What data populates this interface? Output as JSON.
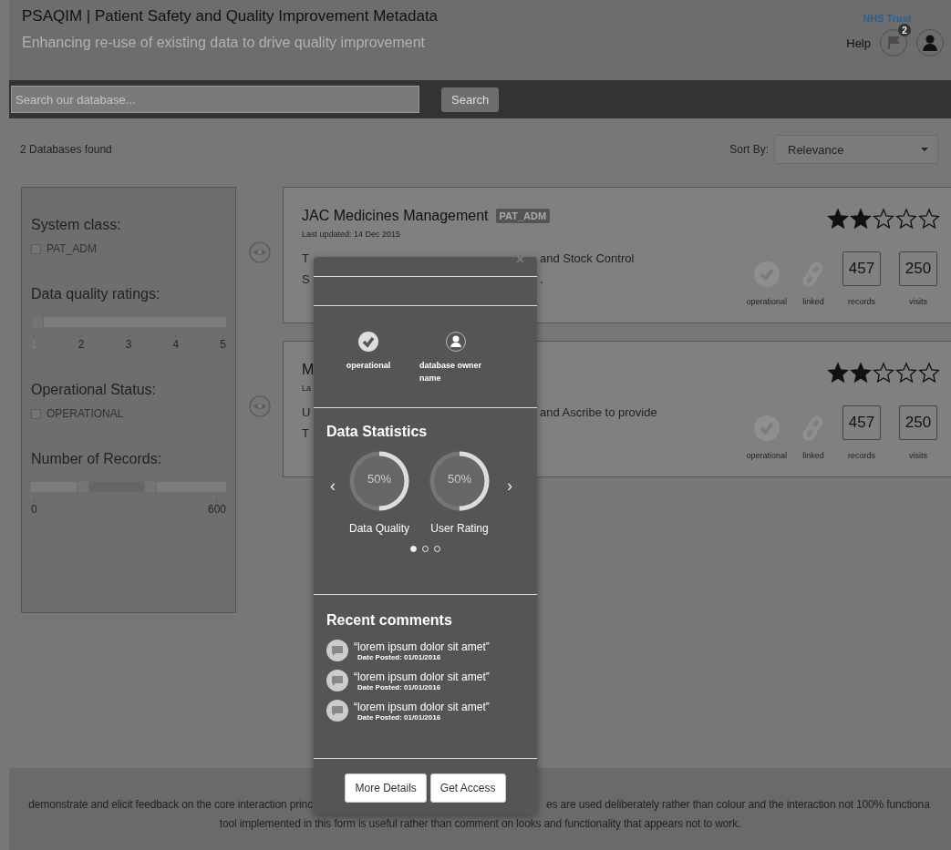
{
  "header": {
    "title": "PSAQIM | Patient Safety and Quality Improvement Metadata",
    "subtitle": "Enhancing re-use of existing data to drive quality improvement",
    "org": "NHS Trust",
    "help": "Help",
    "notifications": "2"
  },
  "search": {
    "placeholder": "Search our database...",
    "button": "Search"
  },
  "results": {
    "count": "2 Databases found",
    "sort_label": "Sort By:",
    "sort_value": "Relevance"
  },
  "filters": [
    {
      "kind": "checkbox",
      "title": "System class:",
      "options": [
        {
          "label": "PAT_ADM",
          "checked": false
        }
      ]
    },
    {
      "kind": "rating",
      "title": "Data quality ratings:",
      "level": 0,
      "ticks": [
        {
          "label": "1",
          "selected": true
        },
        {
          "label": "2",
          "selected": false
        },
        {
          "label": "3",
          "selected": false
        },
        {
          "label": "4",
          "selected": false
        },
        {
          "label": "5",
          "selected": false
        }
      ]
    },
    {
      "kind": "checkbox",
      "title": "Operational Status:",
      "options": [
        {
          "label": "OPERATIONAL",
          "checked": false
        }
      ]
    },
    {
      "kind": "range",
      "title": "Number of Records:",
      "thumbs": [
        {
          "level": 0.25
        },
        {
          "level": 0.62
        }
      ],
      "ticks": [
        "0",
        "600"
      ]
    }
  ],
  "cards": [
    {
      "title": "JAC Medicines Management",
      "tag": "PAT_ADM",
      "updated": "Last updated: 14 Dec 2015",
      "desc_left": [
        "T",
        "S"
      ],
      "desc_right": [
        "and Stock Control",
        "."
      ],
      "stars": 2,
      "status": [
        {
          "kind": "check",
          "label": "operational"
        },
        {
          "kind": "link",
          "label": "linked"
        }
      ],
      "stats": [
        {
          "value": "457",
          "label": "records"
        },
        {
          "value": "250",
          "label": "visits"
        }
      ]
    },
    {
      "title": "M",
      "updated": "La",
      "desc_left": [
        "U",
        "T"
      ],
      "desc_right": [
        "and Ascribe to provide"
      ],
      "stars": 2,
      "status": [
        {
          "kind": "check",
          "label": "operational"
        },
        {
          "kind": "link",
          "label": "linked"
        }
      ],
      "stats": [
        {
          "value": "457",
          "label": "records"
        },
        {
          "value": "250",
          "label": "visits"
        }
      ]
    }
  ],
  "popup": {
    "close": "×",
    "status": "operational",
    "owner": "database owner name",
    "stats_title": "Data Statistics",
    "prev": "‹",
    "next": "›",
    "gauges": [
      {
        "label": "Data Quality",
        "reading": "50%",
        "level": 0.5
      },
      {
        "label": "User Rating",
        "reading": "50%",
        "level": 0.5
      }
    ],
    "pages": [
      {
        "selected": true
      },
      {
        "selected": false
      },
      {
        "selected": false
      }
    ],
    "comments_title": "Recent comments",
    "comments": [
      {
        "text": "“lorem ipsum dolor sit amet”",
        "date": "Date Posted: 01/01/2016"
      },
      {
        "text": "“lorem ipsum dolor sit amet”",
        "date": "Date Posted: 01/01/2016"
      },
      {
        "text": "“lorem ipsum dolor sit amet”",
        "date": "Date Posted: 01/01/2016"
      }
    ],
    "buttons": [
      "More Details",
      "Get Access"
    ]
  },
  "footer": {
    "line1_left": "demonstrate and elicit feedback on the core interaction princ",
    "line1_right": "es are used deliberately rather than colour and the interaction not 100% functiona",
    "line2": "tool implemented in this form is useful rather than comment on looks and functionality that appears not to work."
  }
}
